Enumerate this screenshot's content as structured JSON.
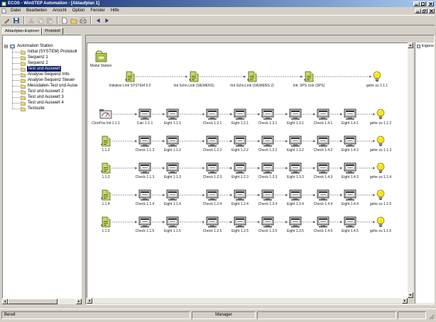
{
  "window": {
    "title": "ECOS - WinSTEP Automation - [Ablaufplan 1]"
  },
  "menu": [
    "Datei",
    "Bearbeiten",
    "Ansicht",
    "Option",
    "Fenster",
    "Hilfe"
  ],
  "toolbar": [
    {
      "icon": "pen-icon",
      "enabled": true
    },
    {
      "icon": "save-icon",
      "enabled": true
    },
    {
      "icon": "separator"
    },
    {
      "icon": "cut-icon",
      "enabled": false
    },
    {
      "icon": "copy-icon",
      "enabled": false
    },
    {
      "icon": "paste-icon",
      "enabled": false
    },
    {
      "icon": "separator"
    },
    {
      "icon": "new-icon",
      "enabled": true
    },
    {
      "icon": "open-icon",
      "enabled": true
    },
    {
      "icon": "print-icon",
      "enabled": true
    },
    {
      "icon": "separator"
    },
    {
      "icon": "back-icon",
      "enabled": true
    },
    {
      "icon": "forward-icon",
      "enabled": true
    }
  ],
  "tabs": [
    {
      "label": "Ablaufplan-Explorer",
      "active": true
    },
    {
      "label": "Protokoll",
      "active": false
    }
  ],
  "tree": {
    "root": "Automation Station",
    "selected_index": 3,
    "items": [
      {
        "label": "Initial (SYSTEM) Protokoll",
        "icon": "folder-icon"
      },
      {
        "label": "Sequenz 1",
        "icon": "folder-icon"
      },
      {
        "label": "Sequenz 2",
        "icon": "folder-icon"
      },
      {
        "label": "Test und Auswert",
        "icon": "folder-icon"
      },
      {
        "label": "Analyse-Sequenz Info",
        "icon": "folder-icon"
      },
      {
        "label": "Analyse-Sequenz Steuer",
        "icon": "folder-icon"
      },
      {
        "label": "Messdaten-Test und Ausw",
        "icon": "folder-icon"
      },
      {
        "label": "Test und Auswert 2",
        "icon": "folder-icon"
      },
      {
        "label": "Test und Auswert 3",
        "icon": "folder-icon"
      },
      {
        "label": "Test und Auswert 4",
        "icon": "folder-icon"
      },
      {
        "label": "Testsuite",
        "icon": "folder-icon"
      }
    ]
  },
  "diagram": {
    "station": {
      "label": "Modul Station",
      "icon": "station-icon"
    },
    "rows": [
      [
        {
          "label": "Initialize Link SYSTEM 0.0",
          "icon": "doc-icon"
        },
        {
          "label": "Init Schn.Link (SIEMENS)",
          "icon": "doc-icon"
        },
        {
          "label": "Init Schn.Link (SIEMENS 2)",
          "icon": "doc-icon"
        },
        {
          "label": "Init. SPS Link (SPS)",
          "icon": "doc-icon"
        },
        {
          "label": "gehe zu 1.1.1",
          "icon": "bulb-icon"
        }
      ],
      [
        {
          "label": "ClonPos.Init 1.1.1",
          "icon": "meter-icon"
        },
        {
          "label": "Calc 1.1.1",
          "icon": "calc-icon"
        },
        {
          "label": "Eight 1.1.1",
          "icon": "calc-icon"
        },
        {
          "label": "Check 1.2.1",
          "icon": "calc-icon"
        },
        {
          "label": "Eight 1.2.1",
          "icon": "calc-icon"
        },
        {
          "label": "Check 1.3.1",
          "icon": "calc-icon"
        },
        {
          "label": "Eight 1.3.1",
          "icon": "calc-icon"
        },
        {
          "label": "Check 1.4.1",
          "icon": "calc-icon"
        },
        {
          "label": "Eight 1.4.1",
          "icon": "calc-icon"
        },
        {
          "label": "gehe zu 1.1.2",
          "icon": "bulb-icon"
        }
      ],
      [
        {
          "label": "1.1.2",
          "icon": "doc-icon"
        },
        {
          "label": "Check 1.1.2",
          "icon": "calc-icon"
        },
        {
          "label": "Eight 1.1.2",
          "icon": "calc-icon"
        },
        {
          "label": "Check 1.2.2",
          "icon": "calc-icon"
        },
        {
          "label": "Eight 1.2.2",
          "icon": "calc-icon"
        },
        {
          "label": "Check 1.3.2",
          "icon": "calc-icon"
        },
        {
          "label": "Eight 1.3.2",
          "icon": "calc-icon"
        },
        {
          "label": "Check 1.4.2",
          "icon": "calc-icon"
        },
        {
          "label": "Eight 1.4.2",
          "icon": "calc-icon"
        },
        {
          "label": "gehe zu 1.1.3",
          "icon": "bulb-icon"
        }
      ],
      [
        {
          "label": "1.1.3",
          "icon": "doc-icon"
        },
        {
          "label": "Check 1.1.3",
          "icon": "calc-icon"
        },
        {
          "label": "Eight 1.1.3",
          "icon": "calc-icon"
        },
        {
          "label": "Check 1.2.3",
          "icon": "calc-icon"
        },
        {
          "label": "Eight 1.2.3",
          "icon": "calc-icon"
        },
        {
          "label": "Check 1.3.3",
          "icon": "calc-icon"
        },
        {
          "label": "Eight 1.3.3",
          "icon": "calc-icon"
        },
        {
          "label": "Check 1.4.3",
          "icon": "calc-icon"
        },
        {
          "label": "Eight 1.4.3",
          "icon": "calc-icon"
        },
        {
          "label": "gehe zu 1.1.4",
          "icon": "bulb-icon"
        }
      ],
      [
        {
          "label": "1.1.4",
          "icon": "doc-icon"
        },
        {
          "label": "Check 1.1.4",
          "icon": "calc-icon"
        },
        {
          "label": "Eight 1.1.4",
          "icon": "calc-icon"
        },
        {
          "label": "Check 1.2.4",
          "icon": "calc-icon"
        },
        {
          "label": "Eight 1.2.4",
          "icon": "calc-icon"
        },
        {
          "label": "Check 1.3.4",
          "icon": "calc-icon"
        },
        {
          "label": "Eight 1.3.4",
          "icon": "calc-icon"
        },
        {
          "label": "Check 1.4.4",
          "icon": "calc-icon"
        },
        {
          "label": "Eight 1.4.4",
          "icon": "calc-icon"
        },
        {
          "label": "gehe zu 1.1.5",
          "icon": "bulb-icon"
        }
      ],
      [
        {
          "label": "1.1.5",
          "icon": "doc-icon"
        },
        {
          "label": "Check 1.1.5",
          "icon": "calc-icon"
        },
        {
          "label": "Eight 1.1.5",
          "icon": "calc-icon"
        },
        {
          "label": "Check 1.2.5",
          "icon": "calc-icon"
        },
        {
          "label": "Eight 1.2.5",
          "icon": "calc-icon"
        },
        {
          "label": "Check 1.3.5",
          "icon": "calc-icon"
        },
        {
          "label": "Eight 1.3.5",
          "icon": "calc-icon"
        },
        {
          "label": "Check 1.4.5",
          "icon": "calc-icon"
        },
        {
          "label": "Eight 1.4.5",
          "icon": "calc-icon"
        },
        {
          "label": "gehe zu 1.1.6",
          "icon": "bulb-icon"
        }
      ]
    ]
  },
  "side_panel": {
    "label": "Eigens"
  },
  "status": {
    "left": "Bereit",
    "center": "Manager"
  },
  "colors": {
    "titlebar_start": "#0a246a",
    "titlebar_end": "#a6caf0",
    "selection": "#0a246a",
    "chrome": "#d4d0c8",
    "canvas": "#ffffff",
    "doc_icon": "#c6d86a",
    "bulb_icon": "#f6e320"
  }
}
